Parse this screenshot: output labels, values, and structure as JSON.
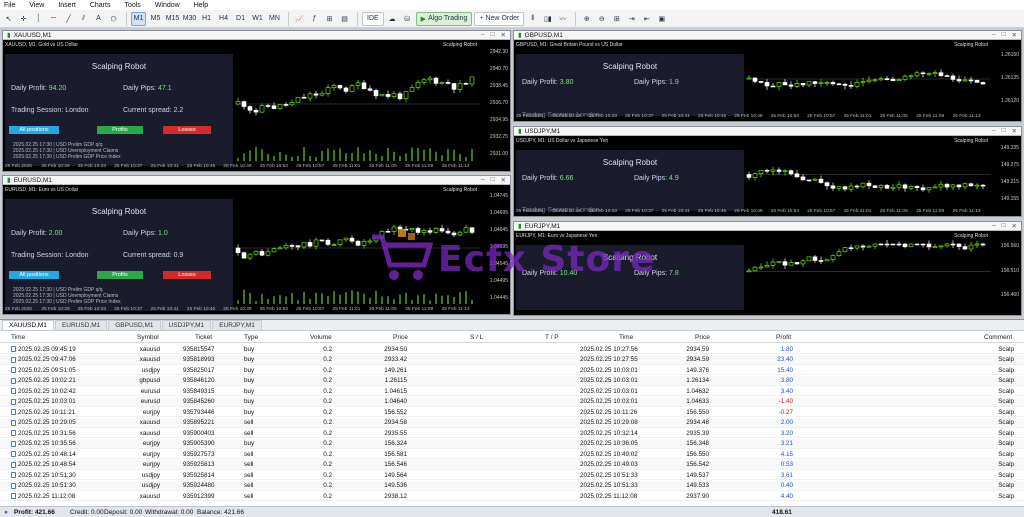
{
  "menu": [
    "File",
    "View",
    "Insert",
    "Charts",
    "Tools",
    "Window",
    "Help"
  ],
  "toolbar": {
    "timeframes": [
      "M1",
      "M5",
      "M15",
      "M30",
      "H1",
      "H4",
      "D1",
      "W1",
      "MN"
    ],
    "active_tf": "M1",
    "ide": "IDE",
    "algo": "Algo Trading",
    "neworder": "New Order"
  },
  "windows": [
    {
      "id": "xau",
      "title": "XAUUSD,M1",
      "info": "XAUUSD, M1: Gold vs US Dollar",
      "robot": "Scalping Robot",
      "panel_title": "Scalping Robot",
      "daily_profit_label": "Daily Profit:",
      "daily_profit": "94.20",
      "daily_pips_label": "Daily Pips:",
      "daily_pips": "47.1",
      "session_label": "Trading Session: London",
      "spread_label": "Current spread:",
      "spread": "2.2",
      "btn_all": "All positions",
      "btn_profits": "Profits",
      "btn_losses": "Losses",
      "news": [
        "2025.02.25  17:30  |  USD    Prelim GDP q/q",
        "2025.02.25  17:30  |  USD    Unemployment Claims",
        "2025.02.25  17:30  |  USD    Prelim GDP Price Index"
      ],
      "prices": [
        "2942.30",
        "2940.70",
        "2938.45",
        "2936.70",
        "2934.95",
        "2932.75",
        "2931.00"
      ],
      "times": [
        "25 Feb 2025",
        "25 Feb 10:29",
        "25 Feb 10:33",
        "25 Feb 10:37",
        "25 Feb 10:41",
        "25 Feb 10:45",
        "25 Feb 10:49",
        "25 Feb 10:53",
        "25 Feb 10:57",
        "25 Feb 11:01",
        "25 Feb 11:05",
        "25 Feb 11:09",
        "25 Feb 11:13"
      ]
    },
    {
      "id": "eur",
      "title": "EURUSD,M1",
      "info": "EURUSD, M1: Euro vs US Dollar",
      "robot": "Scalping Robot",
      "panel_title": "Scalping Robot",
      "daily_profit_label": "Daily Profit:",
      "daily_profit": "2.00",
      "daily_pips_label": "Daily Pips:",
      "daily_pips": "1.0",
      "session_label": "Trading Session: London",
      "spread_label": "Current spread:",
      "spread": "0.9",
      "btn_all": "All positions",
      "btn_profits": "Profits",
      "btn_losses": "Losses",
      "news": [
        "2025.02.25  17:30  |  USD    Prelim GDP q/q",
        "2025.02.25  17:30  |  USD    Unemployment Claims",
        "2025.02.25  17:30  |  USD    Prelim GDP Price Index"
      ],
      "prices": [
        "1.04745",
        "1.04695",
        "1.04645",
        "1.04595",
        "1.04545",
        "1.04495",
        "1.04445"
      ],
      "times": [
        "25 Feb 2025",
        "25 Feb 10:29",
        "25 Feb 10:33",
        "25 Feb 10:37",
        "25 Feb 10:41",
        "25 Feb 10:45",
        "25 Feb 10:49",
        "25 Feb 10:53",
        "25 Feb 10:57",
        "25 Feb 11:01",
        "25 Feb 11:05",
        "25 Feb 11:09",
        "25 Feb 11:13"
      ]
    },
    {
      "id": "gbp",
      "title": "GBPUSD,M1",
      "info": "GBPUSD, M1: Great Britain Pound vs US Dollar",
      "robot": "Scalping Robot",
      "panel_title": "Scalping Robot",
      "daily_profit_label": "Daily Profit:",
      "daily_profit": "3.80",
      "daily_pips_label": "Daily Pips:",
      "daily_pips": "1.9",
      "session_label": "Trading Session: London",
      "spread_label": "Current spread:",
      "spread": "",
      "prices": [
        "1.26150",
        "1.26135",
        "1.26120"
      ],
      "times": [
        "25 Feb 2025",
        "25 Feb 10:29",
        "25 Feb 10:33",
        "25 Feb 10:37",
        "25 Feb 10:41",
        "25 Feb 10:45",
        "25 Feb 10:49",
        "25 Feb 10:53",
        "25 Feb 10:57",
        "25 Feb 11:01",
        "25 Feb 11:05",
        "25 Feb 11:09",
        "25 Feb 11:13"
      ]
    },
    {
      "id": "jpy",
      "title": "USDJPY,M1",
      "info": "USDJPY, M1: US Dollar vs Japanese Yen",
      "robot": "Scalping Robot",
      "panel_title": "Scalping Robot",
      "daily_profit_label": "Daily Profit:",
      "daily_profit": "6.66",
      "daily_pips_label": "Daily Pips:",
      "daily_pips": "4.9",
      "session_label": "Trading Session: London",
      "spread_label": "Current spread:",
      "spread": "",
      "prices": [
        "149.335",
        "149.275",
        "149.215",
        "149.155"
      ],
      "times": [
        "25 Feb 2025",
        "25 Feb 10:29",
        "25 Feb 10:33",
        "25 Feb 10:37",
        "25 Feb 10:41",
        "25 Feb 10:45",
        "25 Feb 10:49",
        "25 Feb 10:53",
        "25 Feb 10:57",
        "25 Feb 11:01",
        "25 Feb 11:05",
        "25 Feb 11:09",
        "25 Feb 11:13"
      ]
    },
    {
      "id": "ej",
      "title": "EURJPY,M1",
      "info": "EURJPY, M1: Euro vs Japanese Yen",
      "robot": "Scalping Robot",
      "panel_title": "Scalping Robot",
      "daily_profit_label": "Daily Profit:",
      "daily_profit": "10.40",
      "daily_pips_label": "Daily Pips:",
      "daily_pips": "7.8",
      "session_label": "",
      "spread_label": "",
      "spread": "",
      "prices": [
        "156.560",
        "156.510",
        "156.460"
      ],
      "times": []
    }
  ],
  "terminal": {
    "tabs": [
      "XAUUSD,M1",
      "EURUSD,M1",
      "GBPUSD,M1",
      "USDJPY,M1",
      "EURJPY,M1"
    ],
    "columns": {
      "time": "Time",
      "symbol": "Symbol",
      "ticket": "Ticket",
      "type": "Type",
      "volume": "Volume",
      "price": "Price",
      "sl": "S / L",
      "tp": "T / P",
      "time2": "Time",
      "price2": "Price",
      "profit": "Profit",
      "comment": "Comment"
    },
    "rows": [
      [
        "2025.02.25 09:45:19",
        "xauusd",
        "935815547",
        "buy",
        "0.2",
        "2934.50",
        "2025.02.25 10:27:56",
        "2934.59",
        "1.80",
        "Scalp"
      ],
      [
        "2025.02.25 09:47:06",
        "xauusd",
        "935818993",
        "buy",
        "0.2",
        "2933.42",
        "2025.02.25 10:27:55",
        "2934.59",
        "23.40",
        "Scalp"
      ],
      [
        "2025.02.25 09:51:05",
        "usdjpy",
        "935825017",
        "buy",
        "0.2",
        "149.261",
        "2025.02.25 10:03:01",
        "149.376",
        "15.40",
        "Scalp"
      ],
      [
        "2025.02.25 10:02:21",
        "gbpusd",
        "935846120",
        "buy",
        "0.2",
        "1.26115",
        "2025.02.25 10:03:01",
        "1.26134",
        "3.80",
        "Scalp"
      ],
      [
        "2025.02.25 10:02:42",
        "eurusd",
        "935849315",
        "buy",
        "0.2",
        "1.04615",
        "2025.02.25 10:03:01",
        "1.04632",
        "3.40",
        "Scalp"
      ],
      [
        "2025.02.25 10:03:01",
        "eurusd",
        "935845260",
        "buy",
        "0.2",
        "1.04640",
        "2025.02.25 10:03:01",
        "1.04633",
        "-1.40",
        "Scalp"
      ],
      [
        "2025.02.25 10:11:21",
        "eurjpy",
        "935793446",
        "buy",
        "0.2",
        "156.552",
        "2025.02.25 10:11:26",
        "156.550",
        "-0.27",
        "Scalp"
      ],
      [
        "2025.02.25 10:29:05",
        "xauusd",
        "935895221",
        "sell",
        "0.2",
        "2934.58",
        "2025.02.25 10:29:08",
        "2934.48",
        "2.00",
        "Scalp"
      ],
      [
        "2025.02.25 10:31:56",
        "xauusd",
        "935900403",
        "sell",
        "0.2",
        "2935.55",
        "2025.02.25 10:32:14",
        "2935.39",
        "3.20",
        "Scalp"
      ],
      [
        "2025.02.25 10:35:56",
        "eurjpy",
        "935905390",
        "buy",
        "0.2",
        "156.324",
        "2025.02.25 10:36:05",
        "156.348",
        "3.21",
        "Scalp"
      ],
      [
        "2025.02.25 10:48:14",
        "eurjpy",
        "935927573",
        "sell",
        "0.2",
        "156.581",
        "2025.02.25 10:49:02",
        "156.550",
        "4.15",
        "Scalp"
      ],
      [
        "2025.02.25 10:48:54",
        "eurjpy",
        "935925813",
        "sell",
        "0.2",
        "156.546",
        "2025.02.25 10:49:03",
        "156.542",
        "0.53",
        "Scalp"
      ],
      [
        "2025.02.25 10:51:30",
        "usdjpy",
        "935925814",
        "sell",
        "0.2",
        "149.564",
        "2025.02.25 10:51:33",
        "149.537",
        "3.61",
        "Scalp"
      ],
      [
        "2025.02.25 10:51:30",
        "usdjpy",
        "935924480",
        "sell",
        "0.2",
        "149.536",
        "2025.02.25 10:51:33",
        "149.533",
        "0.40",
        "Scalp"
      ],
      [
        "2025.02.25 11:12:08",
        "xauusd",
        "935912399",
        "sell",
        "0.2",
        "2938.12",
        "2025.02.25 11:12:08",
        "2937.90",
        "4.40",
        "Scalp"
      ]
    ],
    "status": {
      "profit": "Profit: 421.66",
      "credit": "Credit: 0.00",
      "deposit": "Deposit: 0.00",
      "withdrawal": "Withdrawal: 0.00",
      "balance": "Balance: 421.66",
      "total": "418.61"
    }
  },
  "watermark": "Ecfx Store",
  "colors": {
    "bull": "#7cfc00",
    "bear": "#ffffff",
    "profit_pos": "#1f4fcf",
    "profit_neg": "#d01c1c",
    "panel": "#1a1c2e"
  }
}
